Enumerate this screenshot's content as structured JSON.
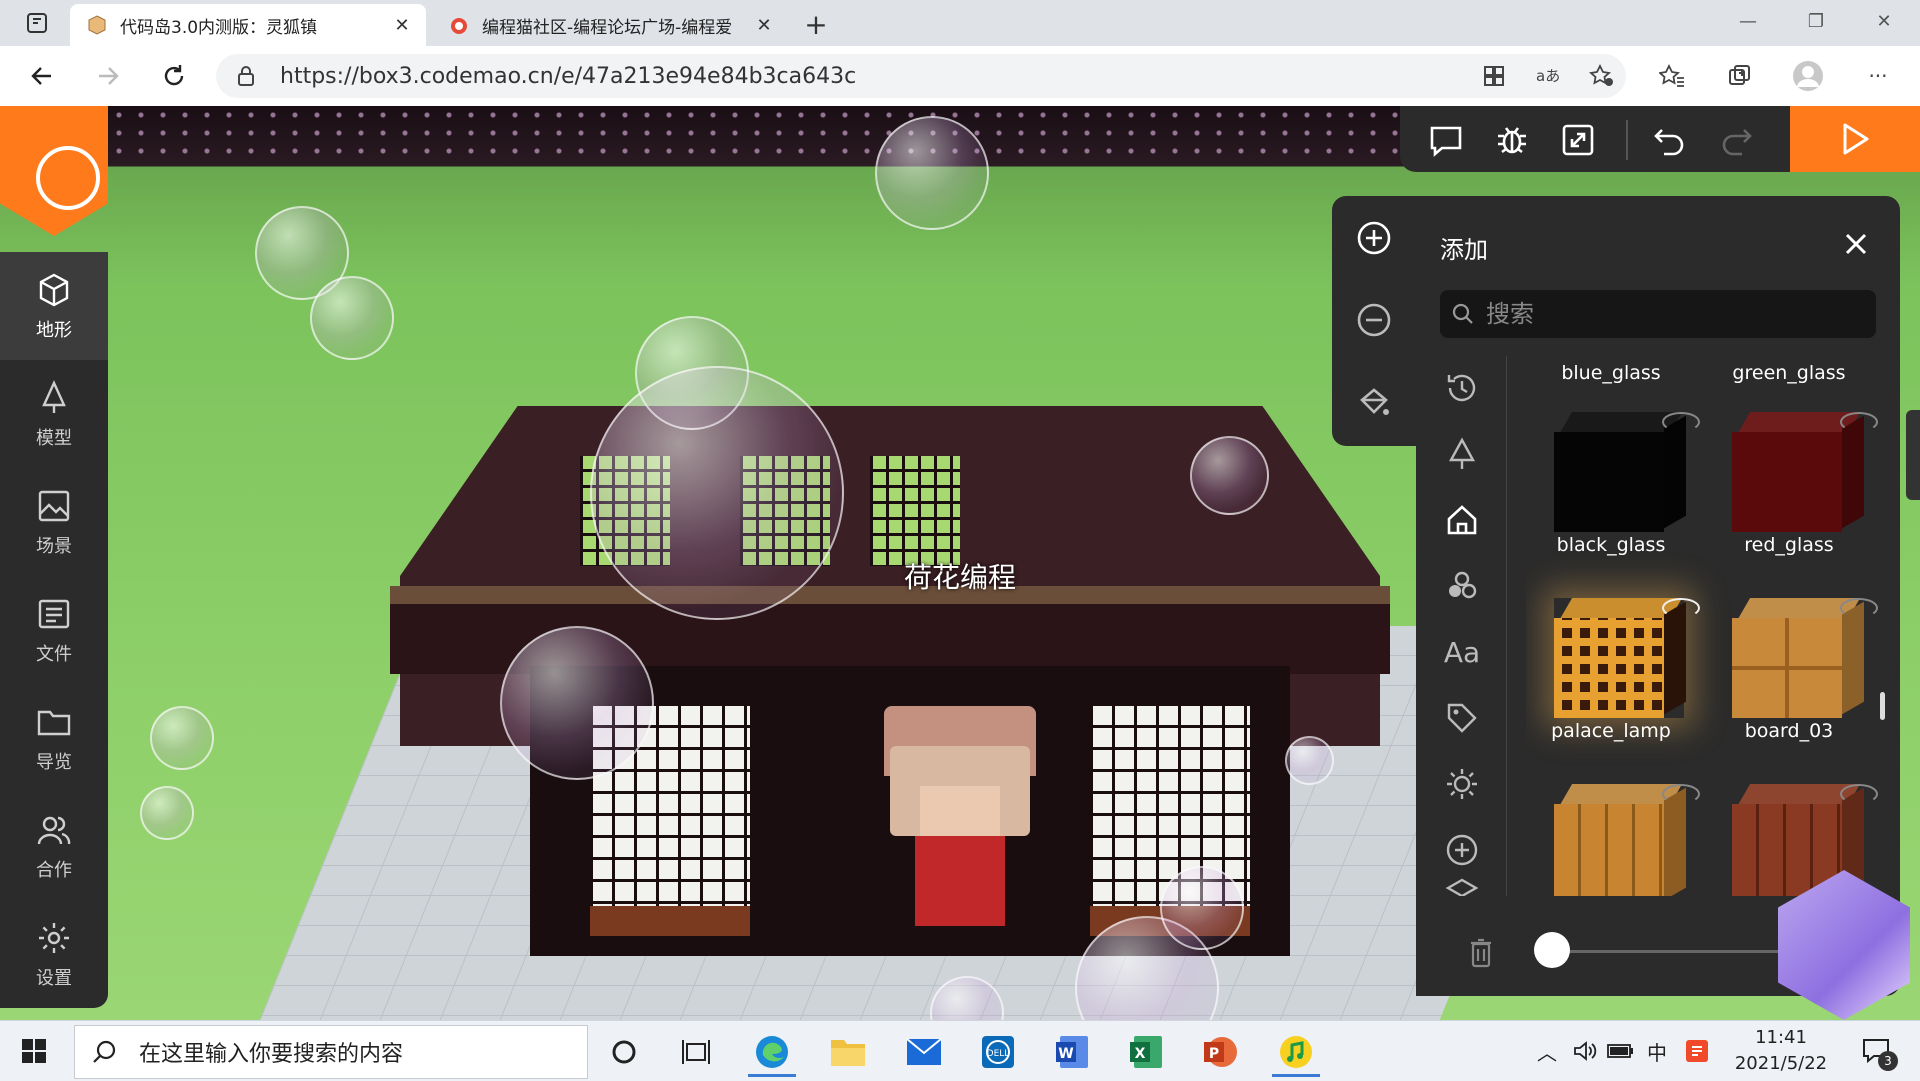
{
  "browser": {
    "tabs": [
      {
        "title": "代码岛3.0内测版：灵狐镇",
        "active": true
      },
      {
        "title": "编程猫社区-编程论坛广场-编程爱",
        "active": false
      }
    ],
    "url": "https://box3.codemao.cn/e/47a213e94e84b3ca643c"
  },
  "colors": {
    "accent": "#ff7a1a",
    "panel_bg": "#2b2b2b",
    "search_bg": "#161616"
  },
  "sidebar": {
    "items": [
      {
        "label": "地形",
        "icon": "cube-icon",
        "active": true
      },
      {
        "label": "模型",
        "icon": "tree-icon",
        "active": false
      },
      {
        "label": "场景",
        "icon": "image-icon",
        "active": false
      },
      {
        "label": "文件",
        "icon": "file-icon",
        "active": false
      },
      {
        "label": "导览",
        "icon": "folder-icon",
        "active": false
      },
      {
        "label": "合作",
        "icon": "users-icon",
        "active": false
      },
      {
        "label": "设置",
        "icon": "gear-icon",
        "active": false
      }
    ]
  },
  "scene": {
    "character_name": "荷花编程"
  },
  "panel": {
    "title": "添加",
    "search_placeholder": "搜索",
    "blocks": [
      {
        "name": "blue_glass",
        "color": "#7ec8e8",
        "top": "#a8dcf0"
      },
      {
        "name": "green_glass",
        "color": "#6ab86a",
        "top": "#8ed08e"
      },
      {
        "name": "black_glass",
        "color": "#050505",
        "top": "#161616"
      },
      {
        "name": "red_glass",
        "color": "#5a0a0a",
        "top": "#7a1a1a"
      },
      {
        "name": "palace_lamp",
        "color": "#3a1a0a",
        "top": "#e8a030"
      },
      {
        "name": "board_03",
        "color": "#c88a3a",
        "top": "#dca050"
      },
      {
        "name": "",
        "color": "#c88430",
        "top": "#dca050"
      },
      {
        "name": "",
        "color": "#8a3a22",
        "top": "#a04a30"
      }
    ]
  },
  "taskbar": {
    "search_placeholder": "在这里输入你要搜索的内容",
    "time": "11:41",
    "date": "2021/5/22",
    "notifications": "3",
    "ime": "中"
  }
}
